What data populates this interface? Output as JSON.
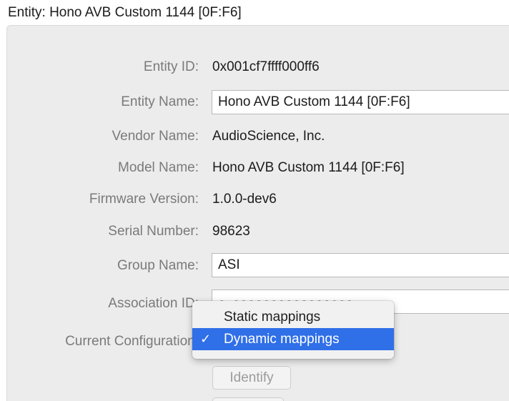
{
  "group": {
    "title": "Entity: Hono AVB Custom 1144 [0F:F6]"
  },
  "fields": {
    "entity_id": {
      "label": "Entity ID:",
      "value": "0x001cf7ffff000ff6"
    },
    "entity_name": {
      "label": "Entity Name:",
      "value": "Hono AVB Custom 1144 [0F:F6]"
    },
    "vendor_name": {
      "label": "Vendor Name:",
      "value": "AudioScience, Inc."
    },
    "model_name": {
      "label": "Model Name:",
      "value": "Hono AVB Custom 1144 [0F:F6]"
    },
    "firmware_version": {
      "label": "Firmware Version:",
      "value": "1.0.0-dev6"
    },
    "serial_number": {
      "label": "Serial Number:",
      "value": "98623"
    },
    "group_name": {
      "label": "Group Name:",
      "value": "ASI"
    },
    "association_id": {
      "label": "Association ID:",
      "value": "0x0000000000000000"
    },
    "current_configuration": {
      "label": "Current Configuration:"
    }
  },
  "configuration_menu": {
    "items": [
      {
        "label": "Static mappings",
        "selected": false,
        "check": ""
      },
      {
        "label": "Dynamic mappings",
        "selected": true,
        "check": "✓"
      }
    ]
  },
  "buttons": {
    "identify_label": "Identify"
  }
}
